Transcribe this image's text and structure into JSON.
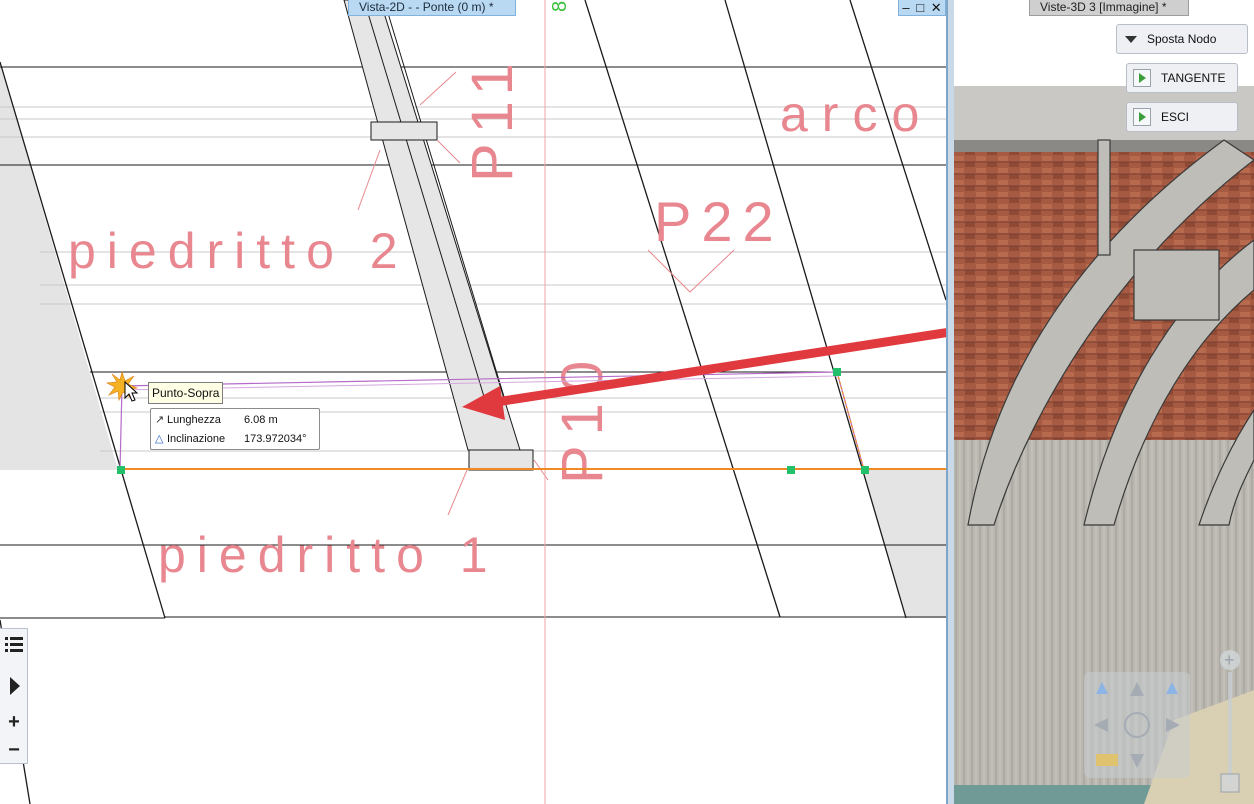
{
  "view2d": {
    "tab_title": "Vista-2D -  - Ponte (0 m) *",
    "labels": {
      "arco": "arco",
      "p11": "P11",
      "p22": "P22",
      "piedritto2": "piedritto 2",
      "piedritto1": "piedritto 1",
      "p10": "P10",
      "axis_mark": "8"
    },
    "snap_tooltip": "Punto-Sopra",
    "measure": {
      "length_label": "Lunghezza",
      "length_value": "6.08 m",
      "incline_label": "Inclinazione",
      "incline_value": "173.972034°"
    },
    "window_controls": {
      "minimize": "–",
      "maximize": "□",
      "close": "✕"
    }
  },
  "view3d": {
    "tab_title": "Viste-3D 3 [Immagine] *",
    "buttons": {
      "sposta_nodo": "Sposta Nodo",
      "tangente": "TANGENTE",
      "esci": "ESCI"
    }
  },
  "left_toolbar": {
    "list_icon": "list-icon",
    "play_icon": "play-icon",
    "plus_label": "+",
    "minus_label": "−"
  },
  "colors": {
    "cad_label_red": "#e8878f",
    "selection_orange": "#f08a24",
    "polyline_magenta": "#b56bc9",
    "node_green": "#22c06a",
    "arrow_red": "#e0393e",
    "axis_green": "#38c03a",
    "tab_blue": "#b9d9f3"
  }
}
